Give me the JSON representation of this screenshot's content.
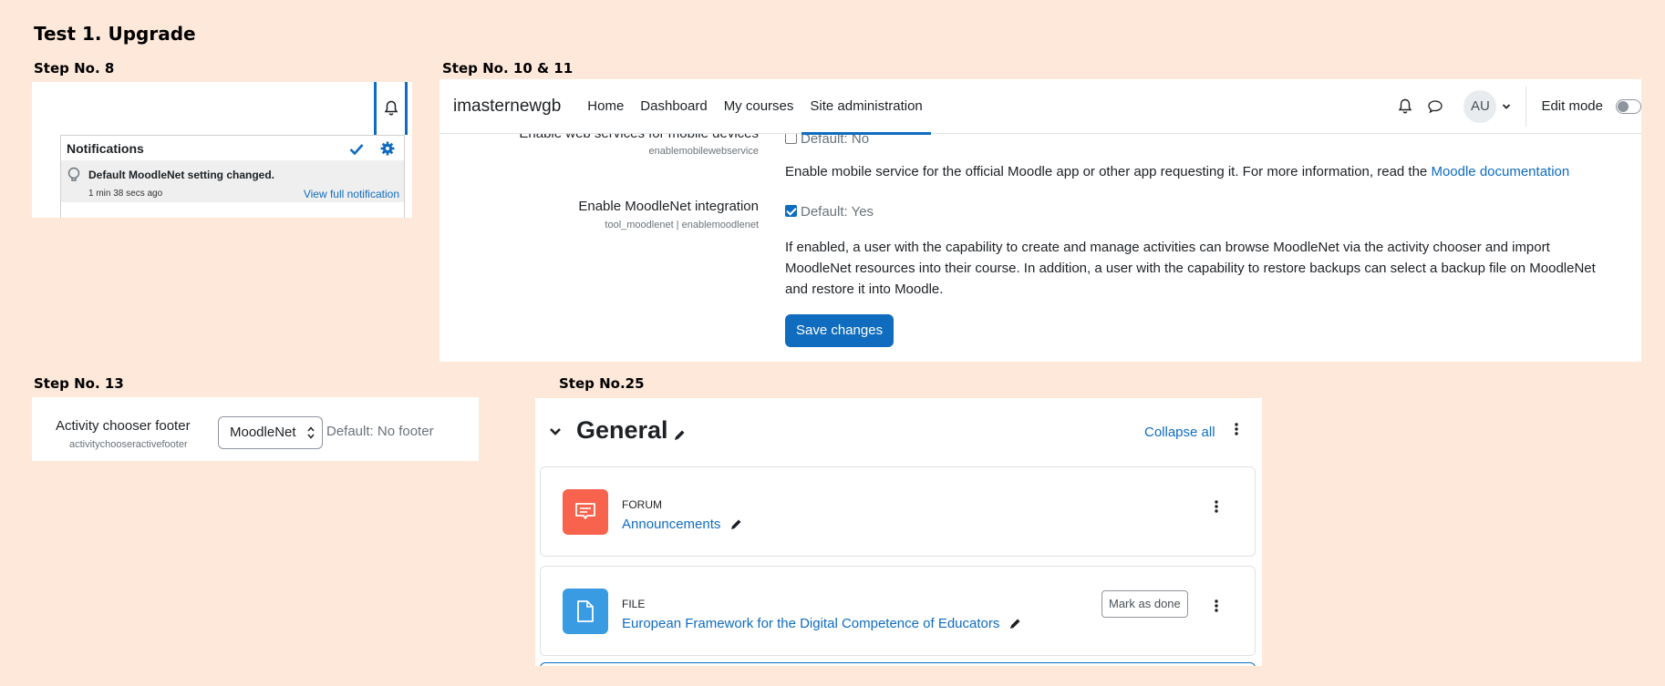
{
  "page_title": "Test 1. Upgrade",
  "steps": {
    "s8": "Step No. 8",
    "s10": "Step No. 10 & 11",
    "s13": "Step No. 13",
    "s25": "Step No.25"
  },
  "notifications": {
    "header": "Notifications",
    "item_title": "Default MoodleNet setting changed.",
    "item_time": "1 min 38 secs ago",
    "item_link": "View full notification"
  },
  "navbar": {
    "brand": "imasternewgb",
    "items": [
      "Home",
      "Dashboard",
      "My courses",
      "Site administration"
    ],
    "active": "Site administration",
    "avatar": "AU",
    "edit_mode": "Edit mode"
  },
  "settings": {
    "mobile": {
      "name": "Enable web services for mobile devices",
      "key": "enablemobilewebservice",
      "default": "Default: No",
      "checked": false,
      "description": "Enable mobile service for the official Moodle app or other app requesting it. For more information, read the",
      "link": "Moodle documentation"
    },
    "moodlenet": {
      "name": "Enable MoodleNet integration",
      "key": "tool_moodlenet | enablemoodlenet",
      "default": "Default: Yes",
      "checked": true,
      "description_line1": "If enabled, a user with the capability to create and manage activities can browse MoodleNet via the activity chooser and import",
      "description_line2": "MoodleNet resources into their course. In addition, a user with the capability to restore backups can select a backup file on MoodleNet",
      "description_line3": "and restore it into Moodle."
    },
    "save_label": "Save changes"
  },
  "chooser_footer": {
    "label": "Activity chooser footer",
    "key": "activitychooseractivefooter",
    "selected": "MoodleNet",
    "default": "Default: No footer"
  },
  "course_section": {
    "title": "General",
    "collapse_label": "Collapse all",
    "activities": [
      {
        "type": "FORUM",
        "name": "Announcements",
        "color": "#f7634d"
      },
      {
        "type": "FILE",
        "name": "European Framework for the Digital Competence of Educators",
        "color": "#399be2",
        "mark_label": "Mark as done"
      }
    ]
  },
  "colors": {
    "background": "#fde8da",
    "primary": "#0f6cbf"
  }
}
